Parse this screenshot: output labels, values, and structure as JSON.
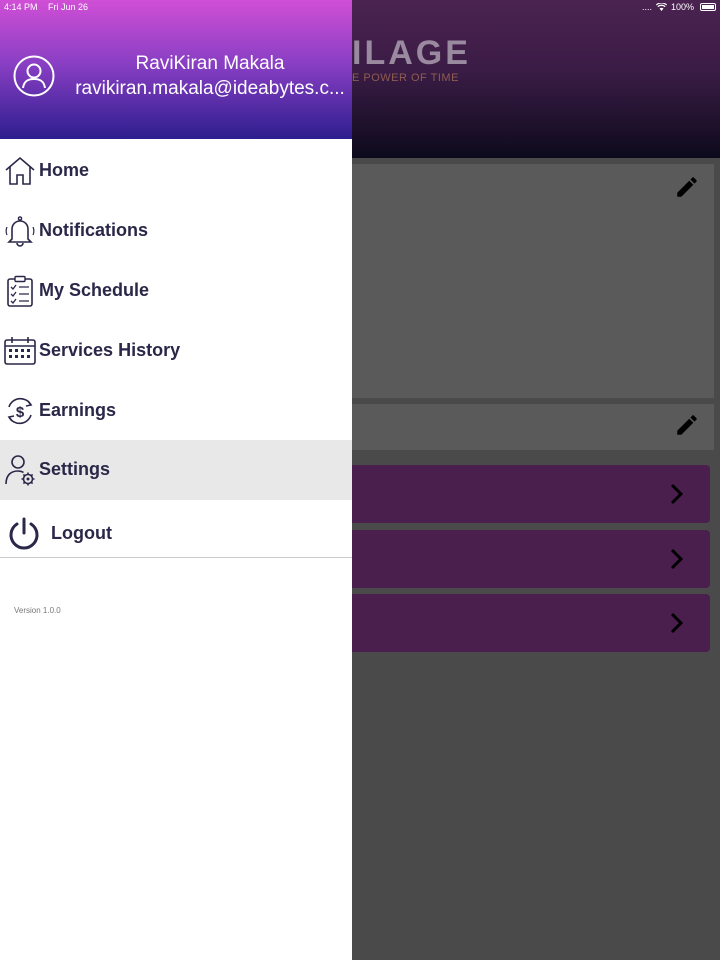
{
  "status_bar": {
    "time": "4:14 PM",
    "date": "Fri Jun 26",
    "signal": "....",
    "battery": "100%"
  },
  "background": {
    "logo_text": "ILAGE",
    "logo_tagline": "E POWER OF TIME",
    "header_color": "#3a1c45",
    "row_color": "#4a1f4e"
  },
  "drawer": {
    "user_name": "RaviKiran Makala",
    "user_email": "ravikiran.makala@ideabytes.c...",
    "header_gradient": [
      "#d04fd6",
      "#2d1e8e"
    ],
    "items": [
      {
        "label": "Home",
        "icon": "home-icon"
      },
      {
        "label": "Notifications",
        "icon": "bell-icon"
      },
      {
        "label": "My Schedule",
        "icon": "clipboard-checklist-icon"
      },
      {
        "label": "Services History",
        "icon": "calendar-icon"
      },
      {
        "label": "Earnings",
        "icon": "dollar-cycle-icon"
      },
      {
        "label": "Settings",
        "icon": "user-gear-icon",
        "selected": true
      }
    ],
    "logout": {
      "label": "Logout",
      "icon": "power-icon"
    },
    "version": "Version 1.0.0"
  }
}
